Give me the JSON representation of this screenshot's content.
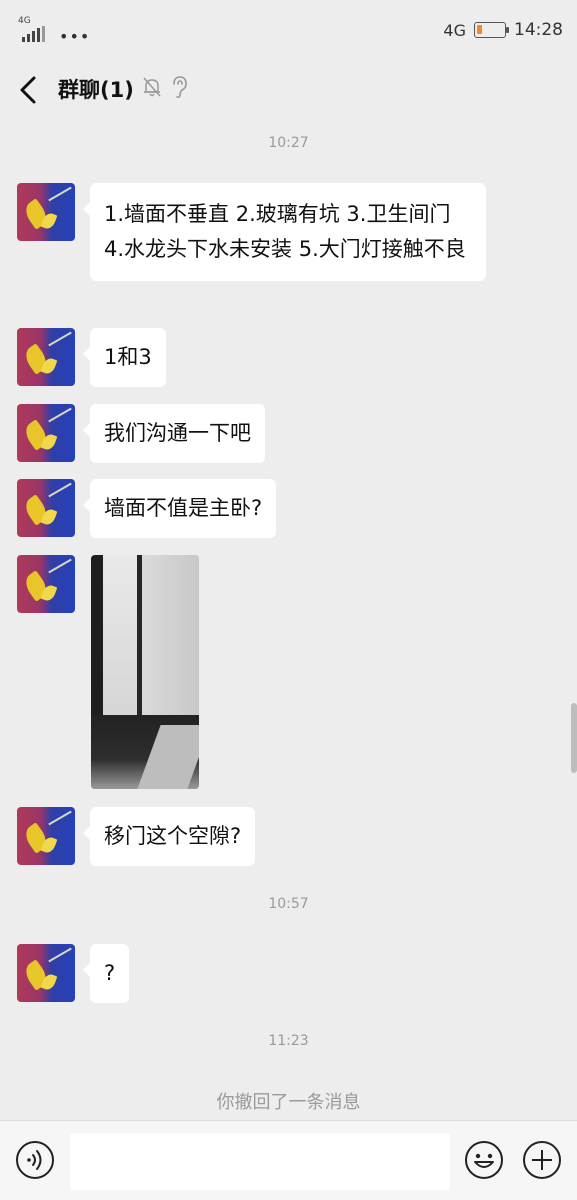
{
  "status_bar": {
    "network_small": "4G",
    "dots": "•••",
    "network": "4G",
    "battery_level": 0.18,
    "battery_color": "#f08a24",
    "time": "14:28"
  },
  "header": {
    "title": "群聊(1)",
    "icons": [
      "back-arrow-icon",
      "mute-bell-icon",
      "ear-icon"
    ]
  },
  "messages": [
    {
      "type": "time",
      "text": "10:27"
    },
    {
      "type": "text",
      "text": "1.墙面不垂直 2.玻璃有坑 3.卫生间门 4.水龙头下水未安装 5.大门灯接触不良"
    },
    {
      "type": "text",
      "text": "1和3"
    },
    {
      "type": "text",
      "text": "我们沟通一下吧"
    },
    {
      "type": "text",
      "text": "墙面不值是主卧?"
    },
    {
      "type": "image",
      "text": ""
    },
    {
      "type": "text",
      "text": "移门这个空隙?"
    },
    {
      "type": "time",
      "text": "10:57"
    },
    {
      "type": "text",
      "text": "?"
    },
    {
      "type": "time",
      "text": "11:23"
    }
  ],
  "recall_note": "你撤回了一条消息",
  "input_bar": {
    "placeholder": "",
    "icons": [
      "voice-icon",
      "emoji-icon",
      "plus-icon"
    ]
  }
}
